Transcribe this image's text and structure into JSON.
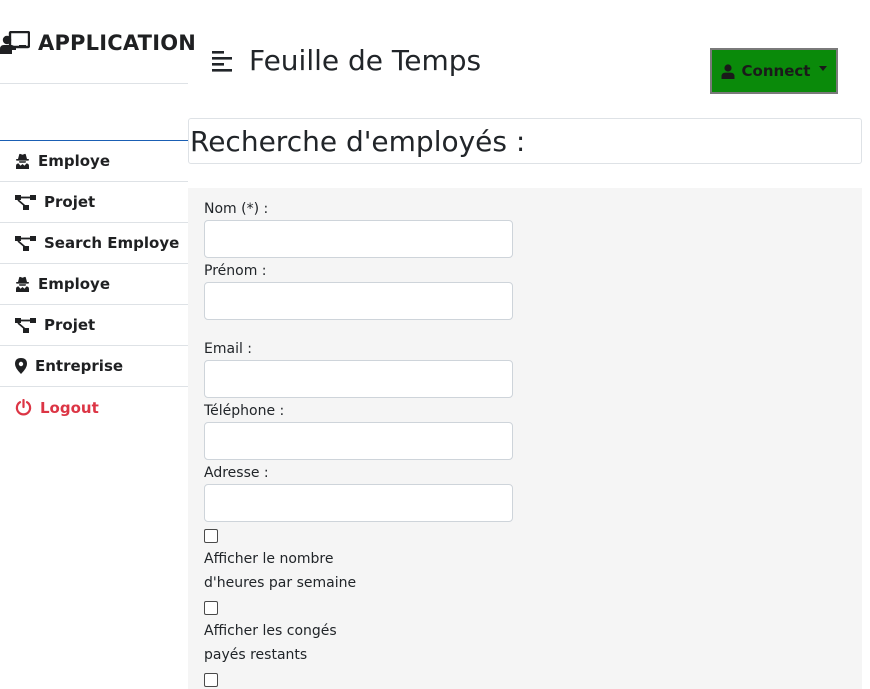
{
  "sidebar": {
    "brand": "APPLICATION",
    "items": [
      {
        "label": "Employe",
        "icon": "user-secret-icon"
      },
      {
        "label": "Projet",
        "icon": "project-diagram-icon"
      },
      {
        "label": "Search Employe",
        "icon": "project-diagram-icon"
      },
      {
        "label": "Employe",
        "icon": "user-secret-icon"
      },
      {
        "label": "Projet",
        "icon": "project-diagram-icon"
      },
      {
        "label": "Entreprise",
        "icon": "map-marker-icon"
      },
      {
        "label": "Logout",
        "icon": "power-icon"
      }
    ]
  },
  "header": {
    "title": "Feuille de Temps",
    "connect_label": "Connect"
  },
  "section": {
    "title": "Recherche d'employés :"
  },
  "form": {
    "nom_label": "Nom (*) :",
    "prenom_label": "Prénom :",
    "email_label": "Email :",
    "telephone_label": "Téléphone :",
    "adresse_label": "Adresse :",
    "checkbox_hours_line1": "Afficher le nombre",
    "checkbox_hours_line2": "d'heures par semaine",
    "checkbox_conges_line1": "Afficher les congés",
    "checkbox_conges_line2": "payés restants"
  },
  "colors": {
    "connect_bg": "#0a8a0a",
    "logout": "#dc3545",
    "panel_bg": "#f5f5f5",
    "nav_accent": "#1a5fb4"
  }
}
